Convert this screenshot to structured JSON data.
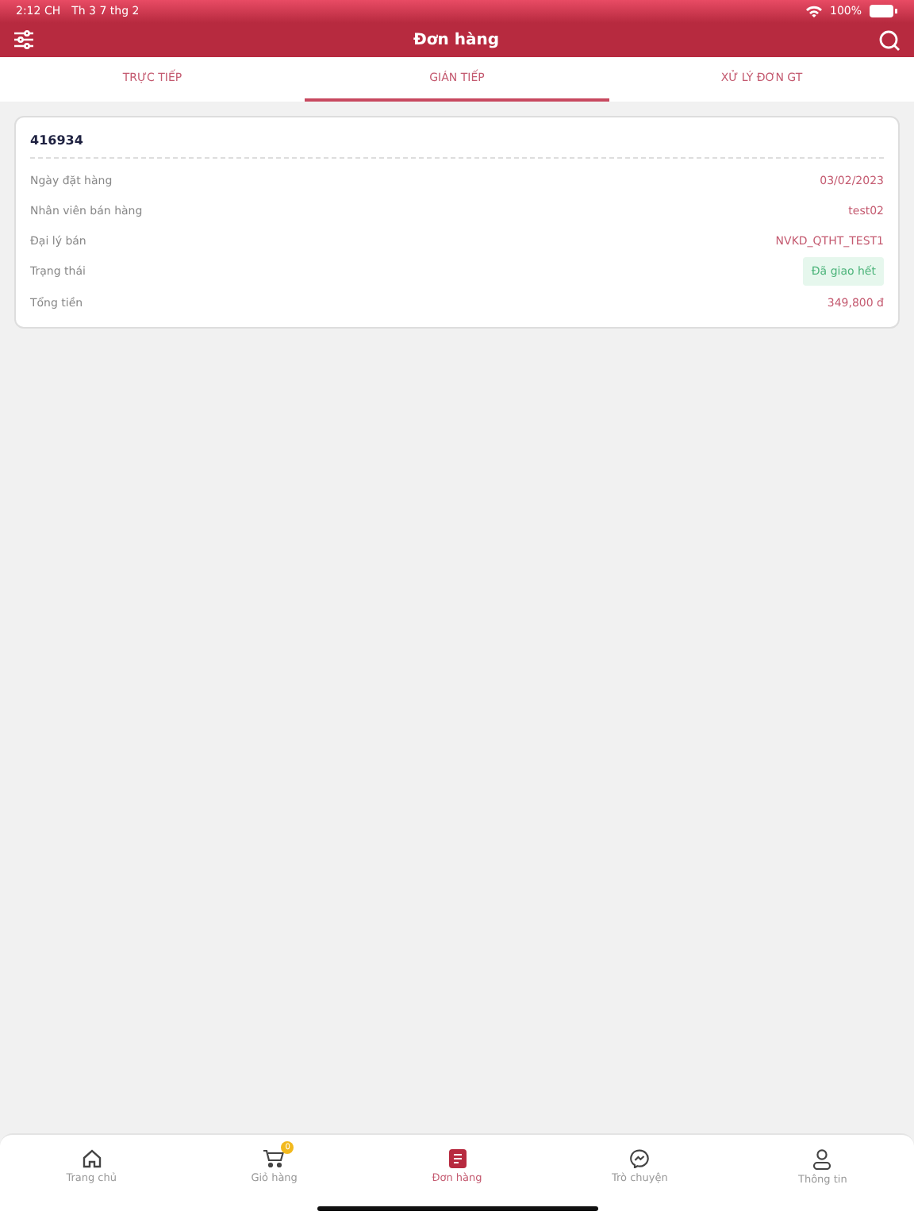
{
  "status_bar": {
    "time": "2:12 CH",
    "date": "Th 3 7 thg 2",
    "battery": "100%"
  },
  "header": {
    "title": "Đơn hàng"
  },
  "tabs": [
    {
      "label": "TRỰC TIẾP",
      "selected": false
    },
    {
      "label": "GIÁN TIẾP",
      "selected": true
    },
    {
      "label": "XỬ LÝ ĐƠN GT",
      "selected": false
    }
  ],
  "orders": [
    {
      "code": "416934",
      "fields": [
        {
          "label": "Ngày đặt hàng",
          "value": "03/02/2023",
          "kind": "text"
        },
        {
          "label": "Nhân viên bán hàng",
          "value": "test02",
          "kind": "text"
        },
        {
          "label": "Đại lý bán",
          "value": "NVKD_QTHT_TEST1",
          "kind": "text"
        },
        {
          "label": "Trạng thái",
          "value": "Đã giao hết",
          "kind": "status"
        },
        {
          "label": "Tổng tiền",
          "value": "349,800 đ",
          "kind": "text"
        }
      ]
    }
  ],
  "bottom_nav": [
    {
      "label": "Trang chủ",
      "kind": "home",
      "selected": false
    },
    {
      "label": "Giỏ hàng",
      "kind": "cart",
      "selected": false,
      "badge": "0"
    },
    {
      "label": "Đơn hàng",
      "kind": "orders",
      "selected": true
    },
    {
      "label": "Trò chuyện",
      "kind": "chat",
      "selected": false
    },
    {
      "label": "Thông tin",
      "kind": "user",
      "selected": false
    }
  ]
}
